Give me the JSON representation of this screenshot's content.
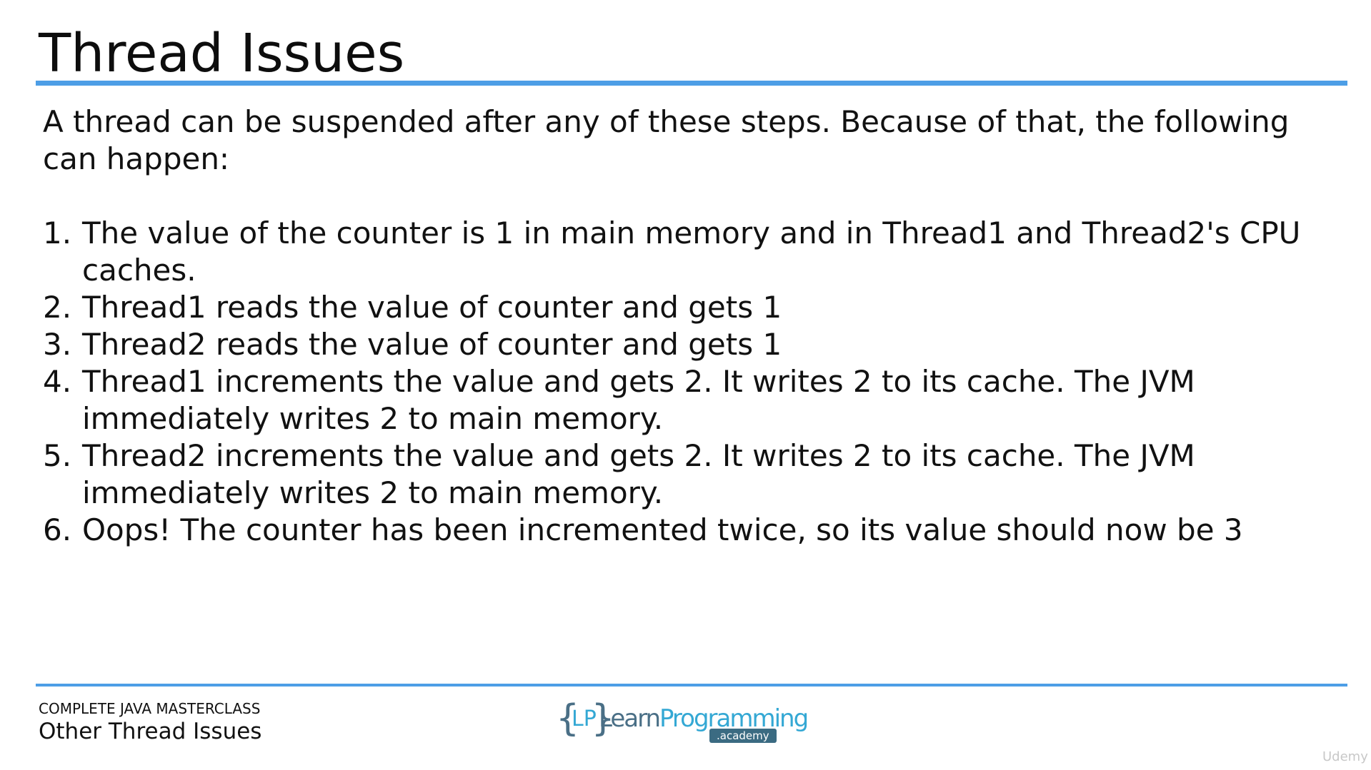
{
  "slide": {
    "title": "Thread Issues",
    "intro": "A thread can be suspended after any of these steps. Because of that, the following can happen:",
    "steps": [
      {
        "number": "1.",
        "text": "The value of the counter is 1 in main memory and in Thread1 and Thread2's CPU caches."
      },
      {
        "number": "2.",
        "text": "Thread1 reads the value of counter and gets 1"
      },
      {
        "number": "3.",
        "text": "Thread2 reads the value of counter and gets 1"
      },
      {
        "number": "4.",
        "text": "Thread1 increments the value and gets 2. It writes 2 to its cache. The JVM immediately writes 2 to main memory."
      },
      {
        "number": "5.",
        "text": "Thread2 increments the value and gets 2. It writes 2 to its cache. The JVM immediately writes 2 to main memory."
      },
      {
        "number": "6.",
        "text": "Oops! The counter has been incremented twice, so its value should now be 3"
      }
    ]
  },
  "footer": {
    "course": "COMPLETE JAVA MASTERCLASS",
    "lecture": "Other Thread Issues",
    "logo": {
      "braces": "{ }",
      "mark": "LP",
      "word_learn": "Learn",
      "word_programming": "Programming",
      "academy": ".academy"
    },
    "watermark": "Udemy"
  },
  "colors": {
    "accent": "#4d9ee6",
    "logo_dark": "#4a6f86",
    "logo_light": "#34a8d4"
  }
}
